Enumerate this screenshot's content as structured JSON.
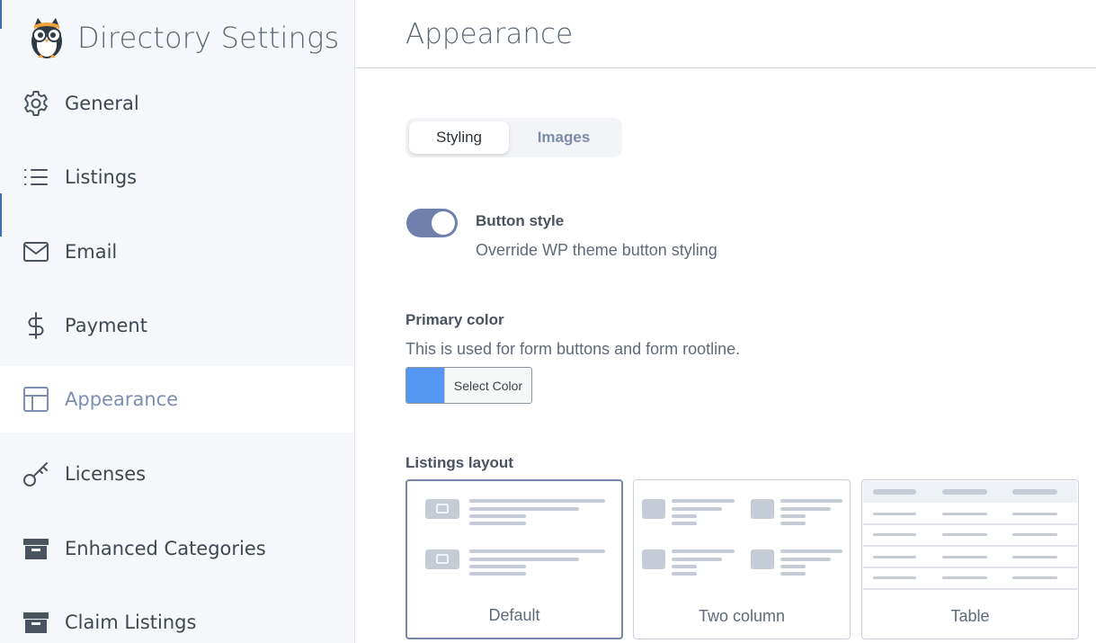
{
  "app": {
    "title": "Directory Settings"
  },
  "sidebar": {
    "items": [
      {
        "label": "General",
        "icon": "gear-icon"
      },
      {
        "label": "Listings",
        "icon": "list-icon"
      },
      {
        "label": "Email",
        "icon": "envelope-icon"
      },
      {
        "label": "Payment",
        "icon": "dollar-icon"
      },
      {
        "label": "Appearance",
        "icon": "layout-icon",
        "active": true
      },
      {
        "label": "Licenses",
        "icon": "key-icon"
      },
      {
        "label": "Enhanced Categories",
        "icon": "archive-icon"
      },
      {
        "label": "Claim Listings",
        "icon": "archive-icon"
      }
    ]
  },
  "page": {
    "title": "Appearance"
  },
  "tabs": [
    {
      "label": "Styling",
      "active": true
    },
    {
      "label": "Images",
      "active": false
    }
  ],
  "button_style": {
    "title": "Button style",
    "description": "Override WP theme button styling",
    "enabled": true
  },
  "primary_color": {
    "title": "Primary color",
    "description": "This is used for form buttons and form rootline.",
    "button_label": "Select Color",
    "value": "#5596f2"
  },
  "listings_layout": {
    "title": "Listings layout",
    "options": [
      {
        "label": "Default",
        "selected": true
      },
      {
        "label": "Two column",
        "selected": false
      },
      {
        "label": "Table",
        "selected": false
      }
    ]
  },
  "colors": {
    "accent": "#6f80ad",
    "active_nav": "#7b8fb3",
    "sidebar_bg": "#f5f7fa"
  }
}
